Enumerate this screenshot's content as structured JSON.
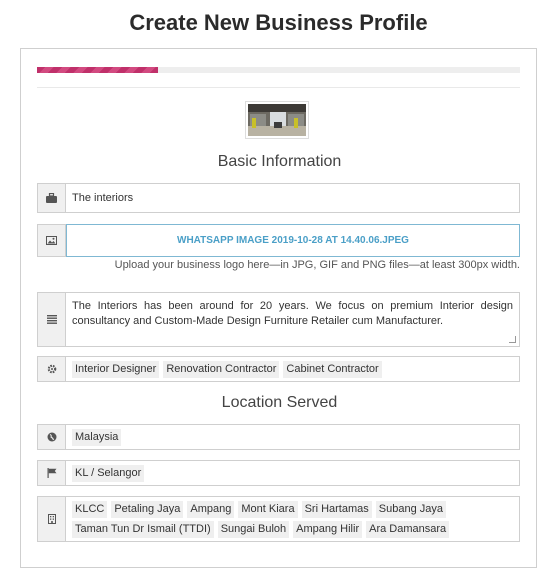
{
  "page": {
    "title": "Create New Business Profile"
  },
  "progress": {
    "fraction": 0.25,
    "color": "#c0306a"
  },
  "basic_info": {
    "heading": "Basic Information",
    "business_name": "The interiors",
    "logo_file": "WHATSAPP IMAGE 2019-10-28 AT 14.40.06.JPEG",
    "logo_help": "Upload your business logo here—in JPG, GIF and PNG files—at least 300px width.",
    "description": "The Interiors has been around for 20 years. We focus on premium Interior design consultancy and Custom-Made Design Furniture Retailer cum Manufacturer.",
    "categories": [
      "Interior Designer",
      "Renovation Contractor",
      "Cabinet Contractor"
    ]
  },
  "location": {
    "heading": "Location Served",
    "country": "Malaysia",
    "state": "KL / Selangor",
    "areas": [
      "KLCC",
      "Petaling Jaya",
      "Ampang",
      "Mont Kiara",
      "Sri Hartamas",
      "Subang Jaya",
      "Taman Tun Dr Ismail (TTDI)",
      "Sungai Buloh",
      "Ampang Hilir",
      "Ara Damansara"
    ]
  },
  "icons": {
    "business_name": "briefcase-icon",
    "logo": "image-icon",
    "description": "align-justify-icon",
    "categories": "gear-icon",
    "country": "globe-icon",
    "state": "flag-icon",
    "areas": "building-icon"
  }
}
